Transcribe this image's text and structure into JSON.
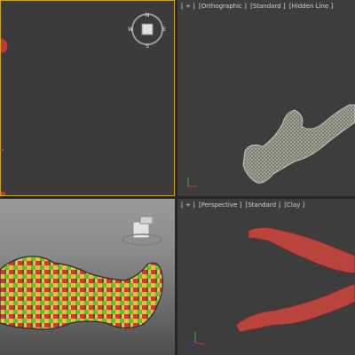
{
  "viewports": [
    {
      "name": "top-left",
      "label_parts": []
    },
    {
      "name": "top-right",
      "label_parts": [
        "[ + ]",
        "[Orthographic ]",
        "[Standard ]",
        "[Hidden Line ]"
      ]
    },
    {
      "name": "bottom-left",
      "label_parts": []
    },
    {
      "name": "bottom-right",
      "label_parts": [
        "[ + ]",
        "[Perspective ]",
        "[Standard ]",
        "[Clay ]"
      ]
    }
  ],
  "viewcube": {
    "north": "N",
    "south": "S",
    "east": "E",
    "west": "W"
  },
  "colors": {
    "active_border": "#c9a227",
    "viewport_bg": "#3d3d3d",
    "clay": "#b9443c",
    "wire": "#b8b8b8",
    "checker_red": "#d23a2a",
    "checker_green": "#5bbf3a",
    "checker_yellow": "#d9c83a"
  }
}
